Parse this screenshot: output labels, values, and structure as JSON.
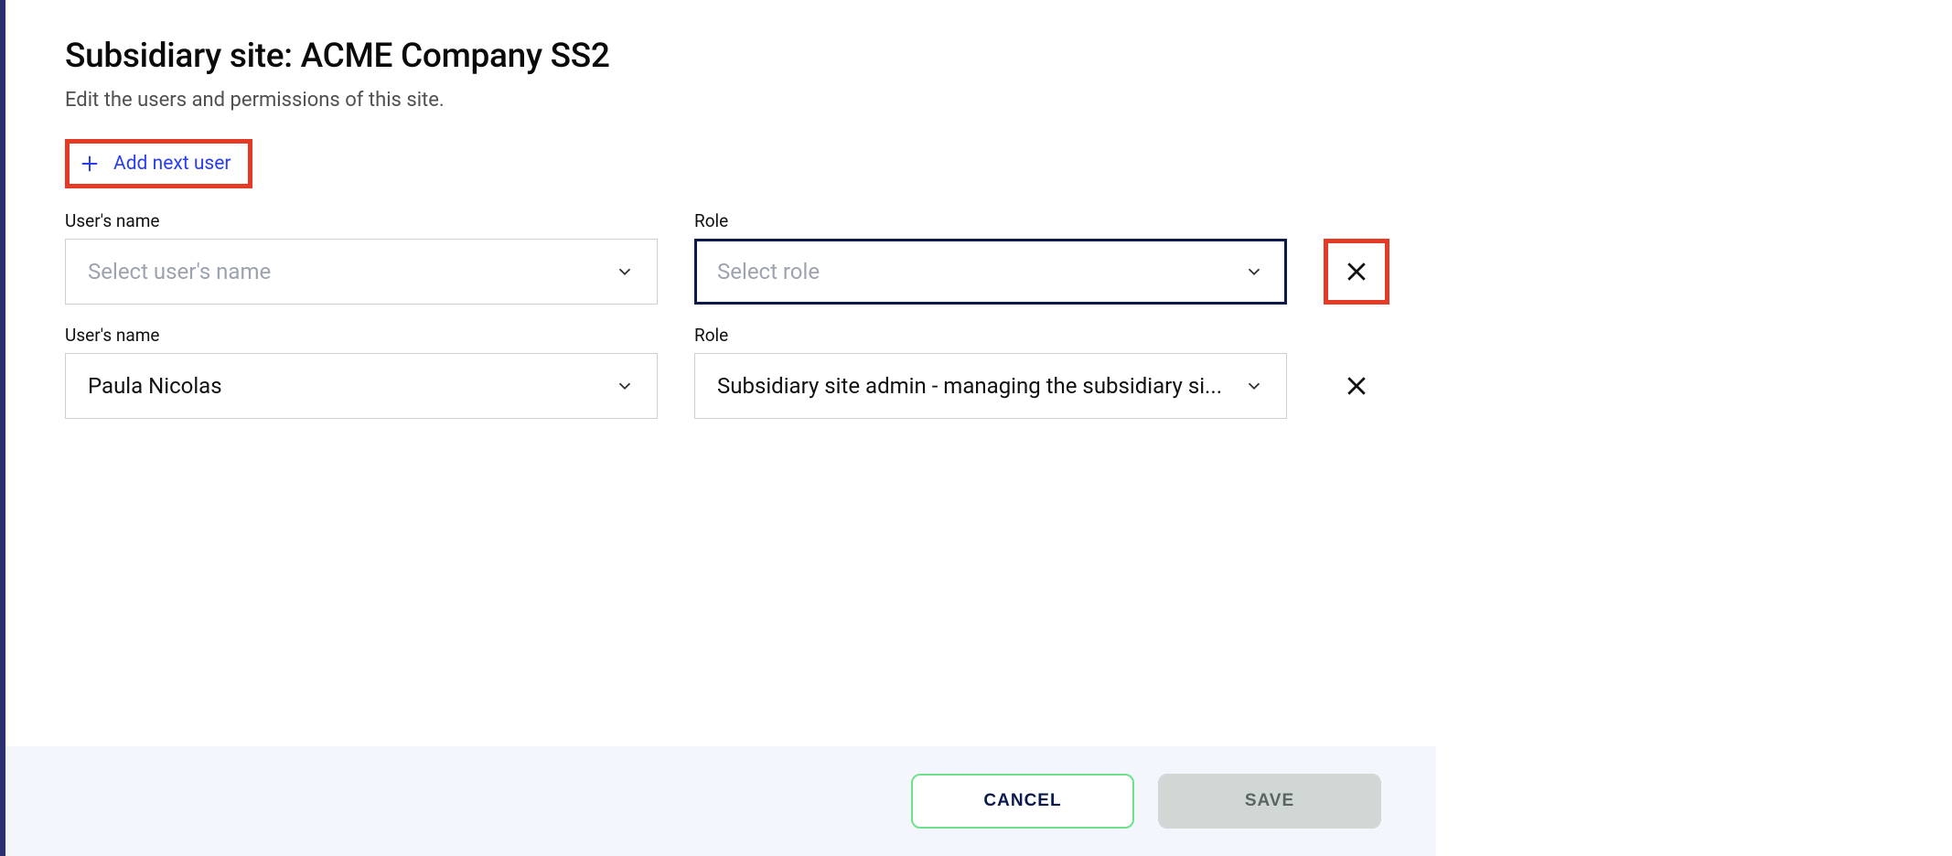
{
  "header": {
    "title": "Subsidiary site: ACME Company SS2",
    "subtitle": "Edit the users and permissions of this site."
  },
  "actions": {
    "add_user_label": "Add next user"
  },
  "labels": {
    "user_name": "User's name",
    "role": "Role"
  },
  "placeholders": {
    "select_user": "Select user's name",
    "select_role": "Select role"
  },
  "rows": [
    {
      "user": "",
      "role": "",
      "role_focused": true,
      "remove_highlight": true
    },
    {
      "user": "Paula Nicolas",
      "role": "Subsidiary site admin - managing the subsidiary si...",
      "role_focused": false,
      "remove_highlight": false
    }
  ],
  "footer": {
    "cancel": "CANCEL",
    "save": "SAVE"
  }
}
